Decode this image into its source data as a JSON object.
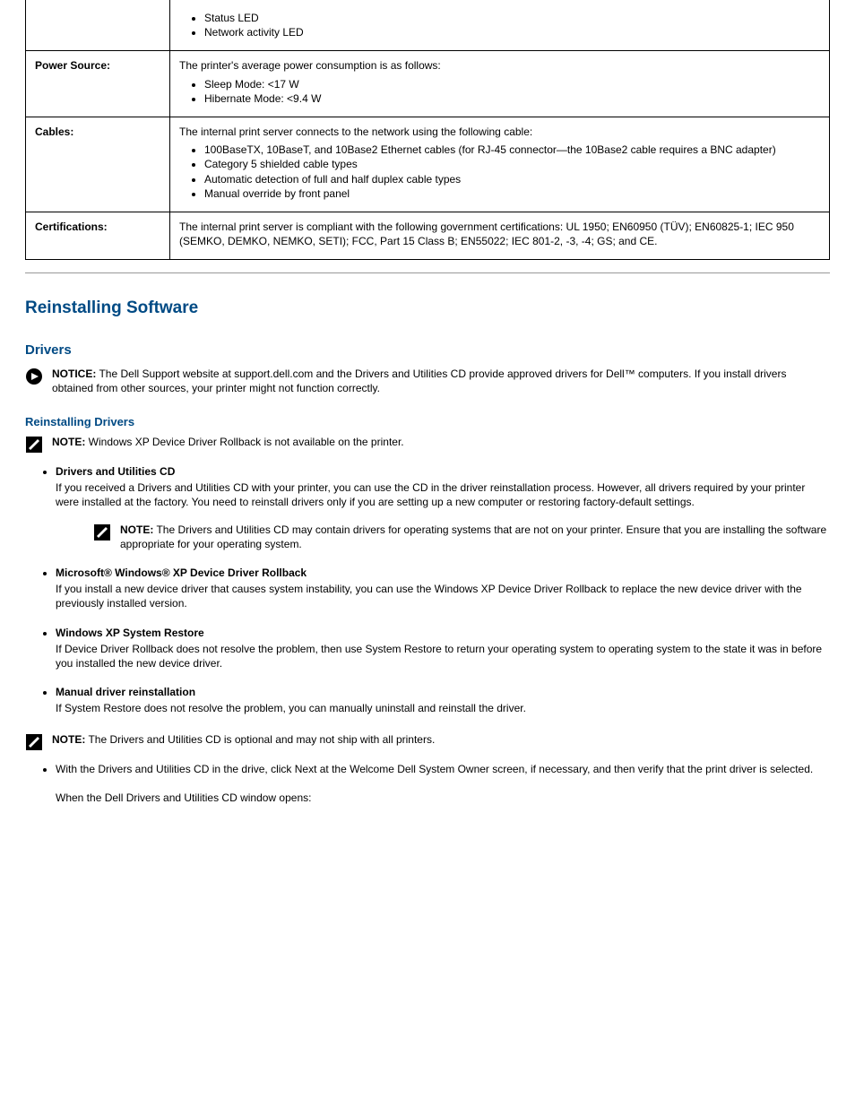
{
  "table": {
    "rows": [
      {
        "key": "",
        "bullets": [
          "Status LED",
          "Network activity LED"
        ]
      },
      {
        "key": "Power Source:",
        "intro": "The printer's average power consumption is as follows:",
        "bullets": [
          "Sleep Mode: <17 W",
          "Hibernate Mode: <9.4 W"
        ]
      },
      {
        "key": "Cables:",
        "intro": "The internal print server connects to the network using the following cable:",
        "bullets": [
          "100BaseTX, 10BaseT, and 10Base2 Ethernet cables (for RJ-45 connector—the 10Base2 cable requires a BNC adapter)",
          "Category 5 shielded cable types",
          "Automatic detection of full and half duplex cable types",
          "Manual override by front panel"
        ]
      },
      {
        "key": "Certifications:",
        "text": "The internal print server is compliant with the following government certifications: UL 1950; EN60950 (TÜV); EN60825-1; IEC 950 (SEMKO, DEMKO, NEMKO, SETI); FCC, Part 15 Class B; EN55022; IEC 801-2, -3, -4; GS; and CE."
      }
    ]
  },
  "section_heading": "Reinstalling Software",
  "subsection_heading": "Drivers",
  "notice": {
    "lead": "NOTICE:",
    "text": " The Dell Support website at support.dell.com and the Drivers and Utilities CD provide approved drivers for Dell™ computers. If you install drivers obtained from other sources, your printer might not function correctly."
  },
  "subsub_heading": "Reinstalling Drivers",
  "note_rollback": {
    "lead": "NOTE:",
    "text": " Windows XP Device Driver Rollback is not available on the printer."
  },
  "steps_intro_none": "",
  "steps": [
    {
      "title": "Drivers and Utilities CD",
      "text": "If you received a Drivers and Utilities CD with your printer, you can use the CD in the driver reinstallation process. However, all drivers required by your printer were installed at the factory. You need to reinstall drivers only if you are setting up a new computer or restoring factory-default settings.",
      "inner_note": {
        "lead": "NOTE:",
        "text": " The Drivers and Utilities CD may contain drivers for operating systems that are not on your printer. Ensure that you are installing the software appropriate for your operating system."
      }
    },
    {
      "title": "Microsoft® Windows® XP Device Driver Rollback",
      "text": "If you install a new device driver that causes system instability, you can use the Windows XP Device Driver Rollback to replace the new device driver with the previously installed version."
    },
    {
      "title": "Windows XP System Restore",
      "text": "If Device Driver Rollback does not resolve the problem, then use System Restore to return your operating system to operating system to the state it was in before you installed the new device driver."
    },
    {
      "title": "Manual driver reinstallation",
      "text": "If System Restore does not resolve the problem, you can manually uninstall and reinstall the driver."
    }
  ],
  "note_cd_optional": {
    "lead": "NOTE:",
    "text": " The Drivers and Utilities CD is optional and may not ship with all printers."
  },
  "final_steps": [
    "With the Drivers and Utilities CD in the drive, click Next at the Welcome Dell System Owner screen, if necessary, and then verify that the print driver is selected."
  ],
  "instruction_open_window": "When the Dell Drivers and Utilities CD window opens:"
}
